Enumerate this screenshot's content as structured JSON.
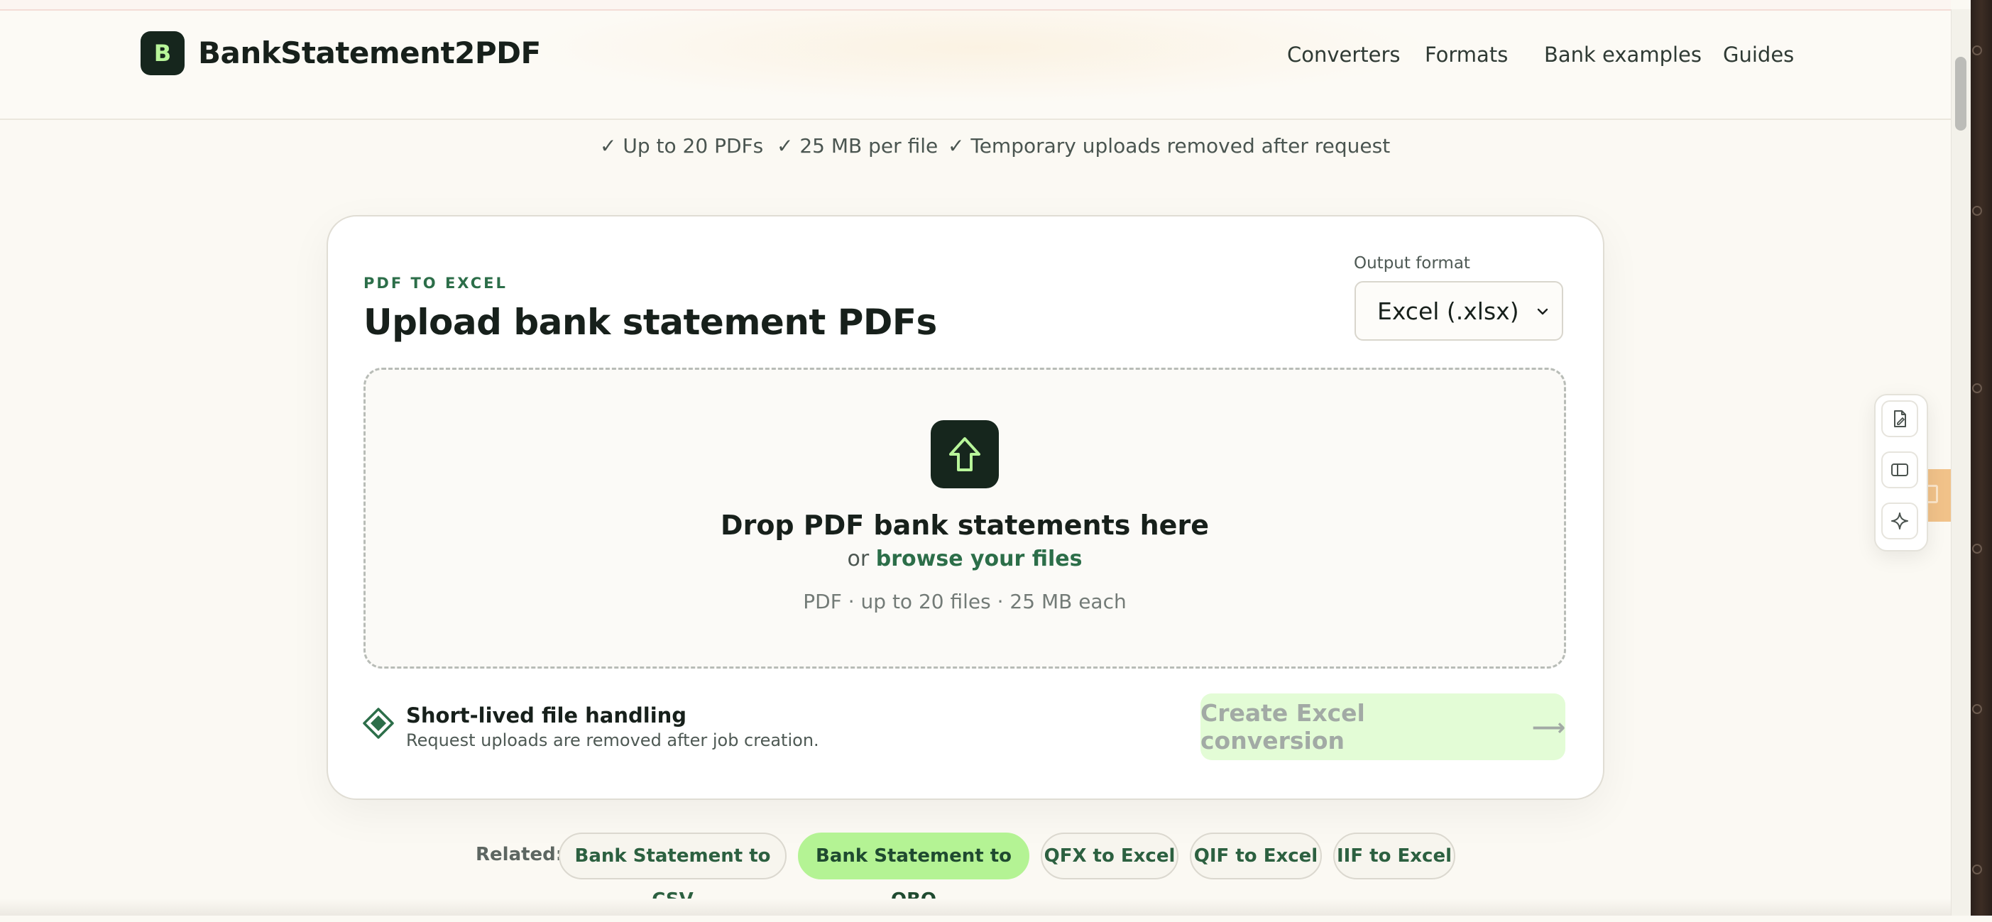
{
  "brand": {
    "logo_letter": "B",
    "name": "BankStatement2PDF"
  },
  "nav": {
    "items": [
      "Converters",
      "Formats",
      "Bank examples",
      "Guides"
    ]
  },
  "features": [
    "✓ Up to 20 PDFs",
    "✓ 25 MB per file",
    "✓ Temporary uploads removed after request"
  ],
  "converter": {
    "eyebrow": "PDF TO EXCEL",
    "title": "Upload bank statement PDFs",
    "output_format_label": "Output format",
    "output_format_value": "Excel (.xlsx)",
    "dropzone": {
      "title": "Drop PDF bank statements here",
      "or_text": "or",
      "browse_text": "browse your files",
      "hint": "PDF · up to 20 files · 25 MB each"
    },
    "security": {
      "title": "Short-lived file handling",
      "subtitle": "Request uploads are removed after job creation."
    },
    "cta_label": "Create Excel conversion",
    "cta_arrow": "⟶"
  },
  "related": {
    "label": "Related:",
    "chips": [
      {
        "label": "Bank Statement to CSV",
        "active": false
      },
      {
        "label": "Bank Statement to QBO",
        "active": true
      },
      {
        "label": "QFX to Excel",
        "active": false
      },
      {
        "label": "QIF to Excel",
        "active": false
      },
      {
        "label": "IIF to Excel",
        "active": false
      }
    ]
  },
  "colors": {
    "accent_green": "#2c6e49",
    "dark_green": "#16261d",
    "lime": "#b4f394",
    "cta_disabled_bg": "#e3fcd6"
  },
  "icons": {
    "upload": "upload-arrow-icon",
    "security": "diamond-shield-icon",
    "toolbar": [
      "pdf-edit-icon",
      "sidebar-panel-icon",
      "sparkle-icon"
    ]
  }
}
